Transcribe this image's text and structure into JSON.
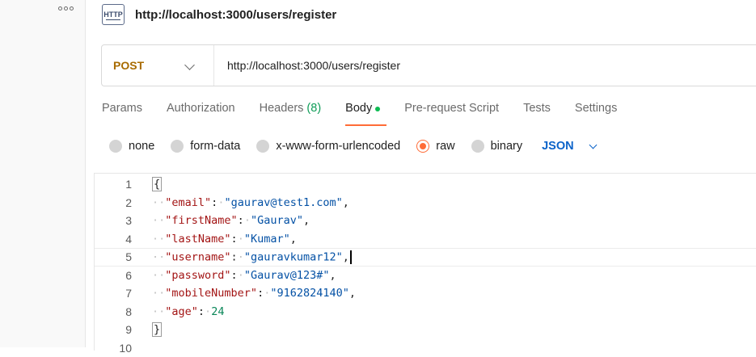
{
  "sidebar": {},
  "request": {
    "title": "http://localhost:3000/users/register",
    "http_icon_text": "HTTP",
    "method": "POST",
    "url": "http://localhost:3000/users/register"
  },
  "tabs": [
    {
      "label": "Params"
    },
    {
      "label": "Authorization"
    },
    {
      "label": "Headers",
      "count": "(8)"
    },
    {
      "label": "Body",
      "active": true
    },
    {
      "label": "Pre-request Script"
    },
    {
      "label": "Tests"
    },
    {
      "label": "Settings"
    }
  ],
  "body_options": {
    "none": "none",
    "form_data": "form-data",
    "urlencoded": "x-www-form-urlencoded",
    "raw": "raw",
    "binary": "binary",
    "format": "JSON"
  },
  "editor": {
    "line_numbers": [
      "1",
      "2",
      "3",
      "4",
      "5",
      "6",
      "7",
      "8",
      "9",
      "10"
    ],
    "open_brace": "{",
    "close_brace": "}",
    "fields": [
      {
        "key": "\"email\"",
        "value": "\"gaurav@test1.com\"",
        "type": "str",
        "comma": ","
      },
      {
        "key": "\"firstName\"",
        "value": "\"Gaurav\"",
        "type": "str",
        "comma": ","
      },
      {
        "key": "\"lastName\"",
        "value": "\"Kumar\"",
        "type": "str",
        "comma": ","
      },
      {
        "key": "\"username\"",
        "value": "\"gauravkumar12\"",
        "type": "str",
        "comma": ","
      },
      {
        "key": "\"password\"",
        "value": "\"Gaurav@123#\"",
        "type": "str",
        "comma": ","
      },
      {
        "key": "\"mobileNumber\"",
        "value": "\"9162824140\"",
        "type": "str",
        "comma": ","
      },
      {
        "key": "\"age\"",
        "value": "24",
        "type": "num",
        "comma": ""
      }
    ]
  },
  "colors": {
    "accent": "#ff6c37",
    "method": "#a86b00",
    "link": "#0b63c9"
  }
}
